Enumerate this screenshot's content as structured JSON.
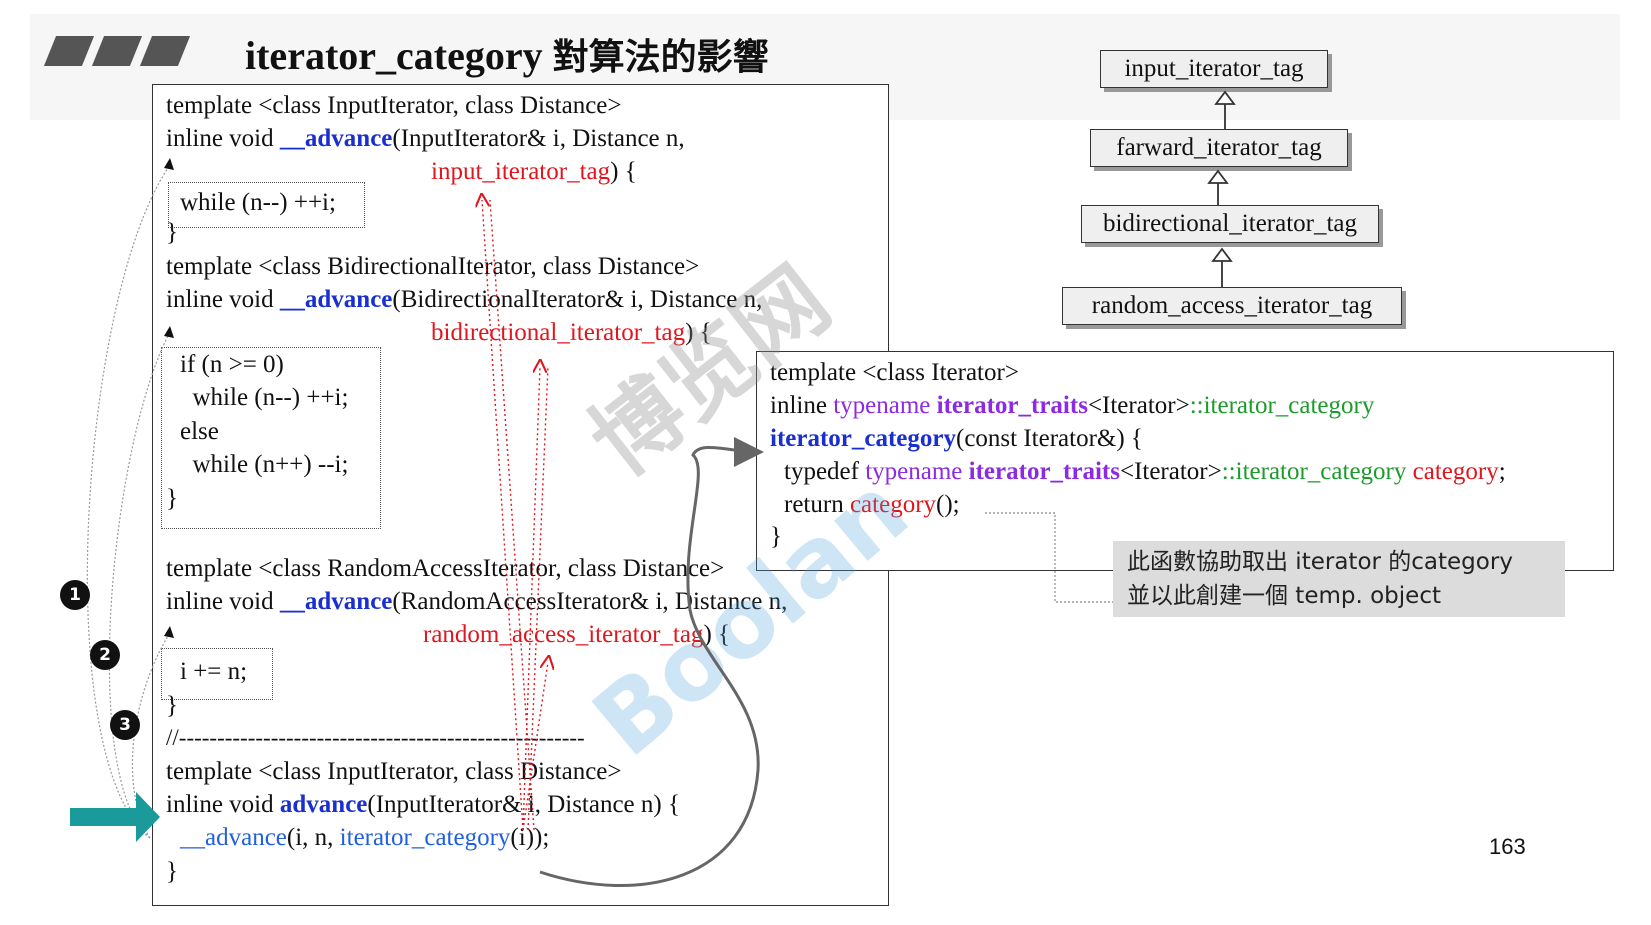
{
  "title": {
    "code_part": "iterator_category ",
    "cjk_part": "對算法的影響"
  },
  "code": {
    "block1": {
      "line1": "template <class InputIterator, class Distance>",
      "line2_pre": "inline void ",
      "line2_fn": "__advance",
      "line2_post": "(InputIterator& i, Distance n,",
      "line3_tag": "input_iterator_tag",
      "line3_post": ") {",
      "body": "while (n--) ++i;",
      "close": "}"
    },
    "block2": {
      "line1": "template <class BidirectionalIterator, class Distance>",
      "line2_pre": "inline void ",
      "line2_fn": "__advance",
      "line2_post": "(BidirectionalIterator& i, Distance n,",
      "line3_tag": "bidirectional_iterator_tag",
      "line3_post": ") {",
      "body1": "if (n >= 0)",
      "body2": "  while (n--) ++i;",
      "body3": "else",
      "body4": "  while (n++) --i;",
      "close": "}"
    },
    "block3": {
      "line1": "template <class RandomAccessIterator, class Distance>",
      "line2_pre": "inline void ",
      "line2_fn": "__advance",
      "line2_post": "(RandomAccessIterator& i, Distance n,",
      "line3_tag": "random_access_iterator_tag",
      "line3_post": ") {",
      "body": "i += n;",
      "close": "}"
    },
    "separator": "//-----------------------------------------------------",
    "block4": {
      "line1": "template <class InputIterator, class Distance>",
      "line2_pre": "inline void ",
      "line2_fn": "advance",
      "line2_post": "(InputIterator& i, Distance n) {",
      "line3_fn": "__advance",
      "line3_mid": "(i, n, ",
      "line3_cat": "iterator_category",
      "line3_post": "(i));",
      "close": "}"
    }
  },
  "hierarchy": [
    "input_iterator_tag",
    "farward_iterator_tag",
    "bidirectional_iterator_tag",
    "random_access_iterator_tag"
  ],
  "iter_code": {
    "line1": "template <class Iterator>",
    "line2_pre": "inline ",
    "line2_typename": "typename ",
    "line2_traits": "iterator_traits",
    "line2_mid": "<Iterator>",
    "line2_cat": "::iterator_category",
    "line3_fn": "iterator_category",
    "line3_post": "(const Iterator&) {",
    "line4_pre": "typedef ",
    "line4_typename": "typename ",
    "line4_traits": "iterator_traits",
    "line4_mid": "<Iterator>",
    "line4_cat": "::iterator_category ",
    "line4_name": "category",
    "line4_post": ";",
    "line5_pre": "return ",
    "line5_name": "category",
    "line5_post": "();",
    "close": "}"
  },
  "note": {
    "line1": "此函數協助取出 iterator 的category",
    "line2": "並以此創建一個 temp. object"
  },
  "markers": [
    "1",
    "2",
    "3"
  ],
  "page_number": "163",
  "watermark": {
    "text1": "博览网",
    "text2": "Boolan"
  },
  "colors": {
    "function_blue": "#1a2fd0",
    "tag_red": "#e0161d",
    "traits_purple": "#8b2be2",
    "category_green": "#1c9a2b",
    "arrow_teal": "#1a9a9a"
  }
}
